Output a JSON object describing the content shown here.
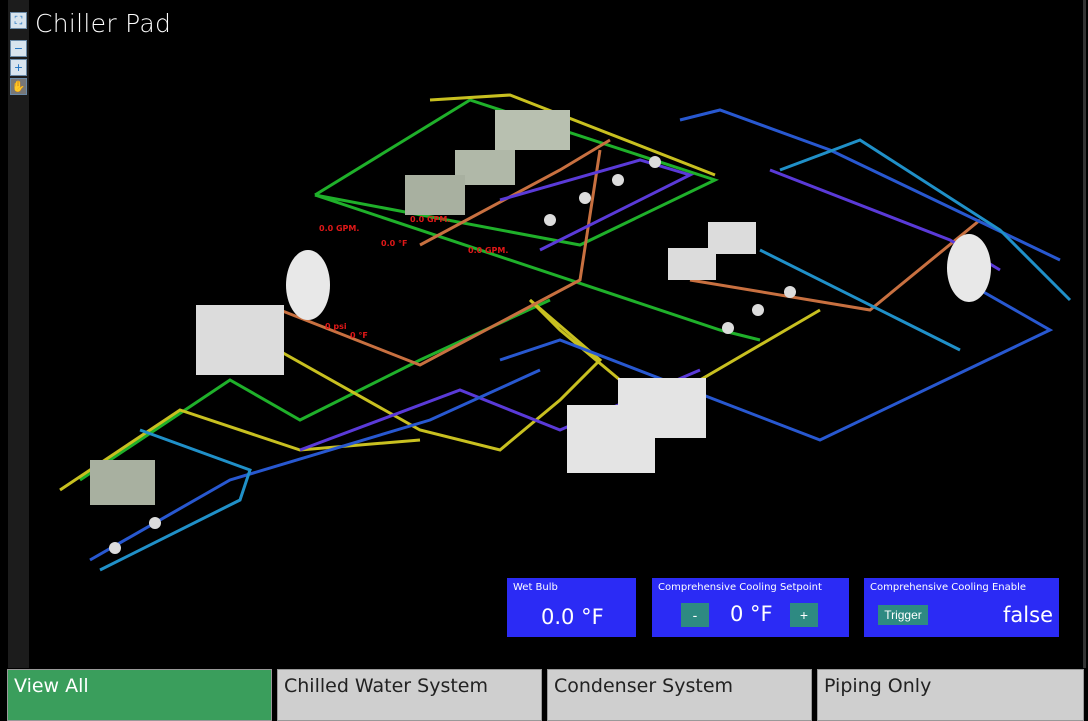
{
  "title": "Chiller Pad",
  "toolbar": {
    "items": [
      {
        "name": "fit-view-icon",
        "glyph": "⛶"
      },
      {
        "name": "zoom-out-icon",
        "glyph": "−"
      },
      {
        "name": "zoom-in-icon",
        "glyph": "+"
      },
      {
        "name": "pan-hand-icon",
        "glyph": "✋"
      }
    ]
  },
  "diagram": {
    "labels": {
      "flow1": "0.0 GPM.",
      "temp1": "0.0 °F",
      "flow2": "0.0 GPM.",
      "flow3": "0.0 GPM.",
      "pressure": "0 psi",
      "temp2": "0 °F"
    },
    "colors": {
      "chilled_supply": "#1fb02a",
      "condenser": "#c8c020",
      "return": "#c87040",
      "purple": "#5a3ad8",
      "blue": "#2858d0",
      "light_blue": "#2090c8"
    }
  },
  "panels": {
    "wet_bulb": {
      "title": "Wet Bulb",
      "value": "0.0 °F"
    },
    "setpoint": {
      "title": "Comprehensive Cooling Setpoint",
      "value": "0 °F",
      "minus": "-",
      "plus": "+"
    },
    "enable": {
      "title": "Comprehensive Cooling Enable",
      "trigger": "Trigger",
      "value": "false"
    }
  },
  "tabs": [
    {
      "label": "View All",
      "active": true
    },
    {
      "label": "Chilled Water System",
      "active": false
    },
    {
      "label": "Condenser System",
      "active": false
    },
    {
      "label": "Piping Only",
      "active": false
    }
  ]
}
